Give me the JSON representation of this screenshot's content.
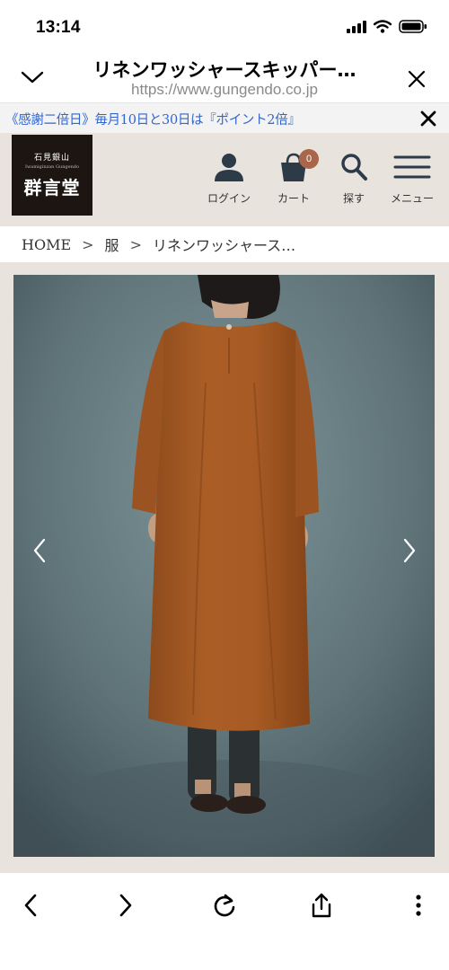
{
  "status_bar": {
    "time": "13:14"
  },
  "browser": {
    "title": "リネンワッシャースキッパー…",
    "url": "https://www.gungendo.co.jp"
  },
  "announcement": {
    "text": "《感謝二倍日》毎月10日と30日は『ポイント2倍』"
  },
  "site": {
    "logo_small": "石見銀山",
    "logo_tiny": "Iwamiginzan Gungendo",
    "logo_main": "群言堂",
    "nav": {
      "login": "ログイン",
      "cart": "カート",
      "cart_count": "0",
      "search": "探す",
      "menu": "メニュー"
    }
  },
  "breadcrumb": {
    "items": [
      "HOME",
      "服",
      "リネンワッシャース…"
    ],
    "separator": ">"
  },
  "colors": {
    "brand_brown": "#a8664a",
    "header_bg": "#e8e3dd",
    "announce_text": "#3366cc",
    "dress": "#a65a23",
    "backdrop": "#5e7277"
  },
  "icons": {
    "status": [
      "signal-icon",
      "wifi-icon",
      "battery-icon"
    ],
    "toolbar": [
      "back-icon",
      "forward-icon",
      "reload-icon",
      "share-icon",
      "more-icon"
    ]
  }
}
